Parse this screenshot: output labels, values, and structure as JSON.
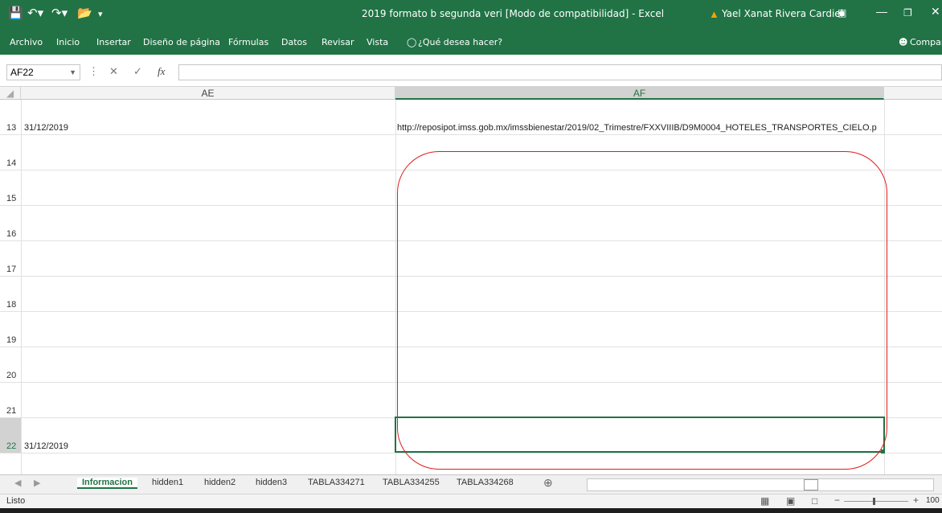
{
  "window": {
    "title": "2019 formato b segunda veri  [Modo de compatibilidad]  -  Excel",
    "user": "Yael Xanat Rivera Cardiel",
    "accent": "#217346"
  },
  "ribbon": {
    "tabs": [
      "Archivo",
      "Inicio",
      "Insertar",
      "Diseño de página",
      "Fórmulas",
      "Datos",
      "Revisar",
      "Vista"
    ],
    "tell_me": "¿Qué desea hacer?",
    "share": "Compar"
  },
  "formula_bar": {
    "name_box": "AF22",
    "value": ""
  },
  "columns": [
    "AE",
    "AF"
  ],
  "rows": [
    {
      "num": "13",
      "ae": "31/12/2019",
      "af": "http://reposipot.imss.gob.mx/imssbienestar/2019/02_Trimestre/FXXVIIIB/D9M0004_HOTELES_TRANSPORTES_CIELO.p"
    },
    {
      "num": "14",
      "ae": "",
      "af": ""
    },
    {
      "num": "15",
      "ae": "",
      "af": ""
    },
    {
      "num": "16",
      "ae": "",
      "af": ""
    },
    {
      "num": "17",
      "ae": "",
      "af": ""
    },
    {
      "num": "18",
      "ae": "",
      "af": ""
    },
    {
      "num": "19",
      "ae": "",
      "af": ""
    },
    {
      "num": "20",
      "ae": "",
      "af": ""
    },
    {
      "num": "21",
      "ae": "",
      "af": ""
    },
    {
      "num": "22",
      "ae": "31/12/2019",
      "af": ""
    }
  ],
  "sheets": [
    "Informacion",
    "hidden1",
    "hidden2",
    "hidden3",
    "TABLA334271",
    "TABLA334255",
    "TABLA334268"
  ],
  "active_sheet": "Informacion",
  "status": {
    "text": "Listo",
    "zoom": "100"
  }
}
